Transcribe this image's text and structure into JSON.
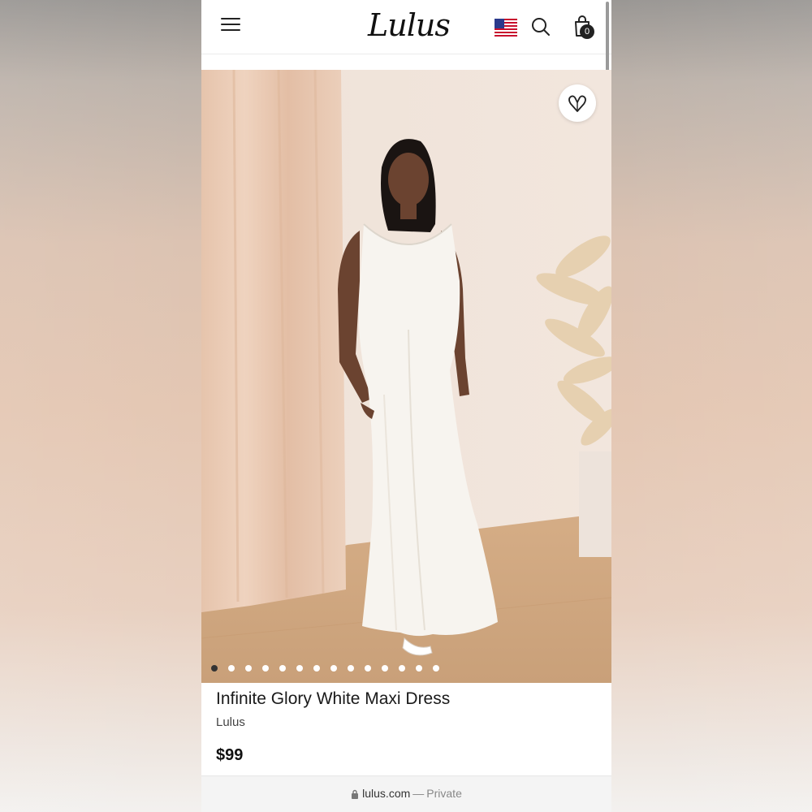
{
  "header": {
    "logo_text": "Lulus",
    "menu_icon": "hamburger-menu-icon",
    "flag_icon": "us-flag-icon",
    "search_icon": "search-icon",
    "cart_icon": "shopping-bag-icon",
    "cart_count": "0"
  },
  "gallery": {
    "wishlist_icon": "heart-icon",
    "image_count": 14,
    "active_index": 0
  },
  "product": {
    "name": "Infinite Glory White Maxi Dress",
    "brand": "Lulus",
    "price": "$99"
  },
  "browser": {
    "url": "lulus.com",
    "separator": "—",
    "mode": "Private"
  }
}
